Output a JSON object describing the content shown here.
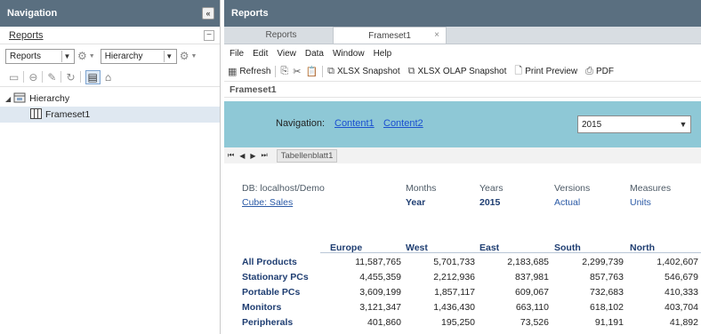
{
  "nav": {
    "title": "Navigation",
    "collapse_glyph": "«",
    "section_label": "Reports",
    "minus_glyph": "−",
    "select_reports": "Reports",
    "select_hierarchy": "Hierarchy",
    "tree": {
      "root": "Hierarchy",
      "child": "Frameset1"
    }
  },
  "reports": {
    "title": "Reports",
    "tabs": [
      {
        "label": "Reports"
      },
      {
        "label": "Frameset1",
        "close": "×"
      }
    ],
    "menu": [
      "File",
      "Edit",
      "View",
      "Data",
      "Window",
      "Help"
    ],
    "toolbar": {
      "refresh": "Refresh",
      "xlsx_snapshot": "XLSX Snapshot",
      "xlsx_olap_snapshot": "XLSX OLAP Snapshot",
      "print_preview": "Print Preview",
      "pdf": "PDF"
    },
    "frame_title": "Frameset1"
  },
  "frame_nav": {
    "label": "Navigation:",
    "link1": "Content1",
    "link2": "Content2",
    "year": "2015",
    "sheet_tab": "Tabellenblatt1",
    "sheet_nav": [
      "⏮",
      "◀",
      "▶",
      "⏭"
    ]
  },
  "report": {
    "db": "DB: localhost/Demo",
    "cube": "Cube: Sales",
    "dims": [
      {
        "name": "Months",
        "value": "Year"
      },
      {
        "name": "Years",
        "value": "2015"
      },
      {
        "name": "Versions",
        "value": "Actual"
      },
      {
        "name": "Measures",
        "value": "Units"
      }
    ],
    "columns": [
      "Europe",
      "West",
      "East",
      "South",
      "North"
    ],
    "rows": [
      {
        "label": "All Products",
        "values": [
          "11,587,765",
          "5,701,733",
          "2,183,685",
          "2,299,739",
          "1,402,607"
        ]
      },
      {
        "label": "Stationary PCs",
        "values": [
          "4,455,359",
          "2,212,936",
          "837,981",
          "857,763",
          "546,679"
        ]
      },
      {
        "label": "Portable PCs",
        "values": [
          "3,609,199",
          "1,857,117",
          "609,067",
          "732,683",
          "410,333"
        ]
      },
      {
        "label": "Monitors",
        "values": [
          "3,121,347",
          "1,436,430",
          "663,110",
          "618,102",
          "403,704"
        ]
      },
      {
        "label": "Peripherals",
        "values": [
          "401,860",
          "195,250",
          "73,526",
          "91,191",
          "41,892"
        ]
      }
    ]
  },
  "colors": {
    "header_bg": "#5a6f80",
    "band_bg": "#8ec8d6",
    "link": "#1a4fd0",
    "label_blue": "#1f3e72",
    "selection_bg": "#dfe8f1"
  }
}
